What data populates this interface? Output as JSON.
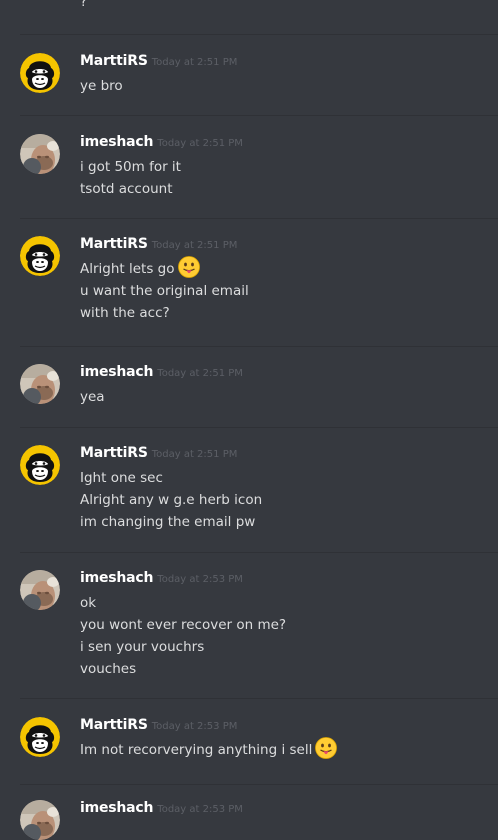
{
  "top_fragment": "?",
  "messages": [
    {
      "author": "MarttiRS",
      "avatar": "gorilla-icon",
      "time": "Today at 2:51 PM",
      "lines": [
        {
          "text": "ye bro"
        }
      ]
    },
    {
      "author": "imeshach",
      "avatar": "user-photo",
      "time": "Today at 2:51 PM",
      "lines": [
        {
          "text": "i got 50m for it"
        },
        {
          "text": "tsotd account"
        }
      ]
    },
    {
      "author": "MarttiRS",
      "avatar": "gorilla-icon",
      "time": "Today at 2:51 PM",
      "lines": [
        {
          "text": "Alright lets go",
          "emoji": "tongue-face-emoji"
        },
        {
          "text": "u want the original email"
        },
        {
          "text": "with the acc?"
        }
      ]
    },
    {
      "author": "imeshach",
      "avatar": "user-photo",
      "time": "Today at 2:51 PM",
      "lines": [
        {
          "text": "yea"
        }
      ]
    },
    {
      "author": "MarttiRS",
      "avatar": "gorilla-icon",
      "time": "Today at 2:51 PM",
      "lines": [
        {
          "text": "Ight one sec"
        },
        {
          "text": "Alright any w g.e herb icon"
        },
        {
          "text": "im changing the email pw"
        }
      ]
    },
    {
      "author": "imeshach",
      "avatar": "user-photo",
      "time": "Today at 2:53 PM",
      "lines": [
        {
          "text": "ok"
        },
        {
          "text": "you wont ever recover on me?"
        },
        {
          "text": "i sen your vouchrs"
        },
        {
          "text": "vouches"
        }
      ]
    },
    {
      "author": "MarttiRS",
      "avatar": "gorilla-icon",
      "time": "Today at 2:53 PM",
      "lines": [
        {
          "text": "Im not recorverying anything i sell",
          "emoji": "tongue-face-emoji"
        }
      ]
    },
    {
      "author": "imeshach",
      "avatar": "user-photo",
      "time": "Today at 2:53 PM",
      "lines": []
    }
  ],
  "colors": {
    "background": "#36393f",
    "divider": "#2f3136",
    "username": "#ffffff",
    "timestamp": "#5c5f66",
    "message_text": "#dcddde",
    "gorilla_avatar_bg": "#f5c400"
  }
}
